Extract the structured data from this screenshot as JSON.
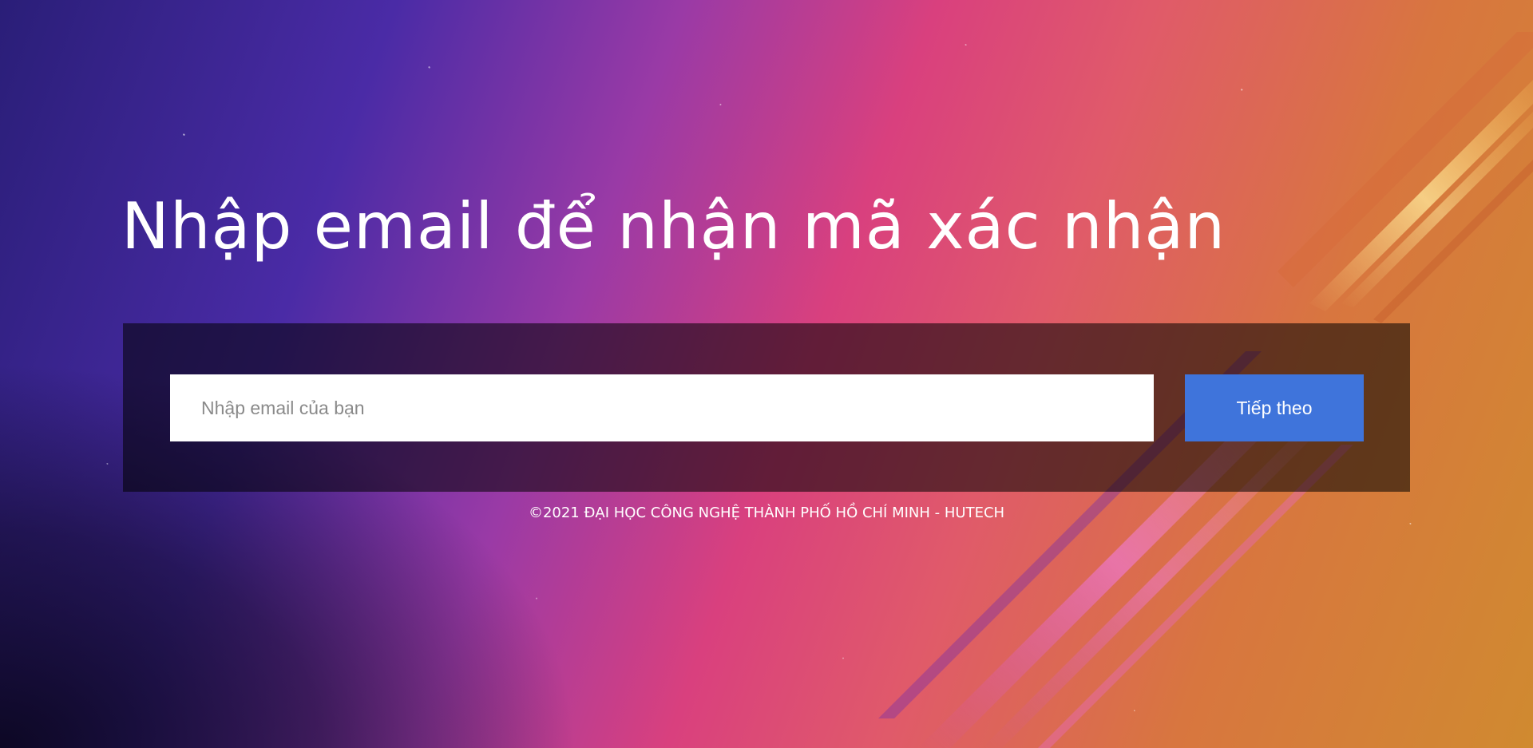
{
  "page": {
    "heading": "Nhập email để nhận mã xác nhận"
  },
  "form": {
    "email_placeholder": "Nhập email của bạn",
    "email_value": "",
    "submit_label": "Tiếp theo"
  },
  "footer": {
    "copyright": "©2021 ĐẠI HỌC CÔNG NGHỆ THÀNH PHỐ HỒ CHÍ MINH - HUTECH"
  },
  "colors": {
    "button": "#3f74db",
    "panel": "rgba(0,0,0,0.55)",
    "text": "#ffffff"
  }
}
